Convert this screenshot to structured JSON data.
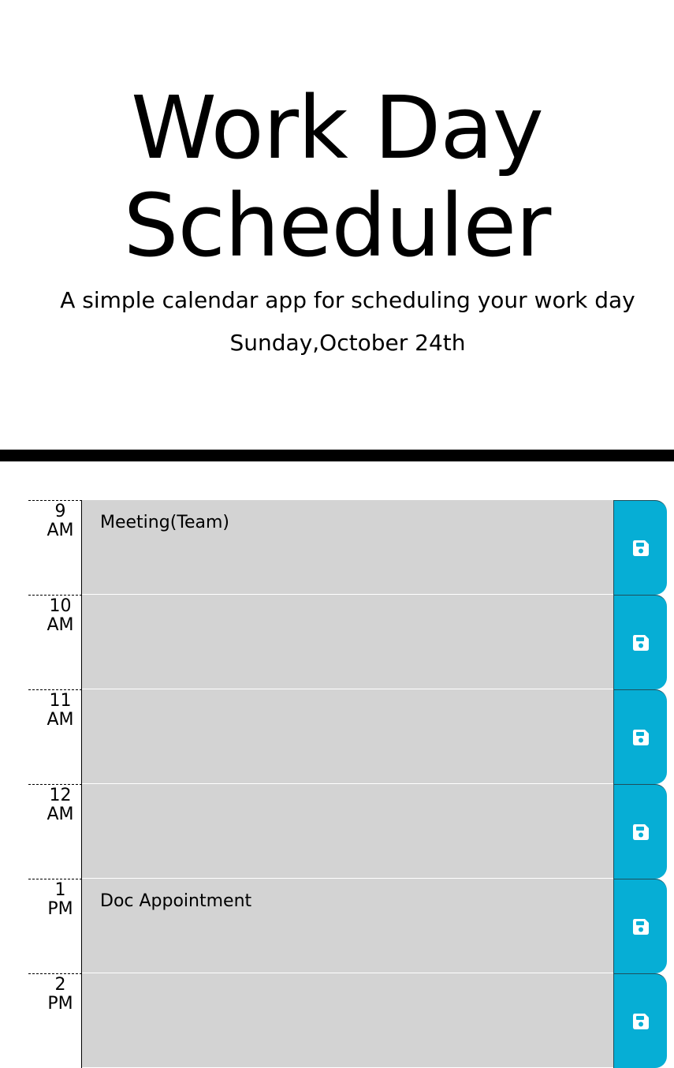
{
  "header": {
    "title_line1": "Work Day",
    "title_line2": "Scheduler",
    "subtitle": "A simple calendar app for scheduling your work day",
    "current_day": "Sunday,October 24th"
  },
  "timeblocks": [
    {
      "hour": "9",
      "period": "AM",
      "description": "Meeting(Team)",
      "save_icon": "save-icon"
    },
    {
      "hour": "10",
      "period": "AM",
      "description": "",
      "save_icon": "save-icon"
    },
    {
      "hour": "11",
      "period": "AM",
      "description": "",
      "save_icon": "save-icon"
    },
    {
      "hour": "12",
      "period": "AM",
      "description": "",
      "save_icon": "save-icon"
    },
    {
      "hour": "1",
      "period": "PM",
      "description": "Doc Appointment",
      "save_icon": "save-icon"
    },
    {
      "hour": "2",
      "period": "PM",
      "description": "",
      "save_icon": "save-icon"
    }
  ],
  "colors": {
    "save_button": "#06aed5",
    "past_block": "#d3d3d3",
    "divider": "#000000"
  }
}
